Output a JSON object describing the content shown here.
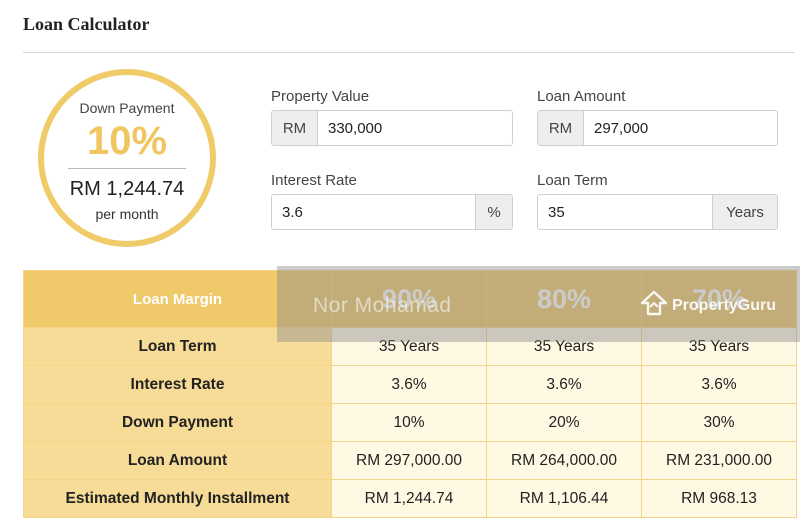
{
  "header": {
    "title": "Loan Calculator"
  },
  "summary": {
    "down_payment_label": "Down Payment",
    "down_payment_pct": "10%",
    "monthly_amount": "RM 1,244.74",
    "per_month": "per month"
  },
  "inputs": {
    "property_value": {
      "label": "Property Value",
      "prefix": "RM",
      "value": "330,000"
    },
    "loan_amount": {
      "label": "Loan Amount",
      "prefix": "RM",
      "value": "297,000"
    },
    "interest_rate": {
      "label": "Interest Rate",
      "suffix": "%",
      "value": "3.6"
    },
    "loan_term": {
      "label": "Loan Term",
      "suffix": "Years",
      "value": "35"
    }
  },
  "table": {
    "header_label": "Loan Margin",
    "margins": [
      "90%",
      "80%",
      "70%"
    ],
    "rows": [
      {
        "label": "Loan Term",
        "values": [
          "35 Years",
          "35 Years",
          "35 Years"
        ]
      },
      {
        "label": "Interest Rate",
        "values": [
          "3.6%",
          "3.6%",
          "3.6%"
        ]
      },
      {
        "label": "Down Payment",
        "values": [
          "10%",
          "20%",
          "30%"
        ]
      },
      {
        "label": "Loan Amount",
        "values": [
          "RM 297,000.00",
          "RM 264,000.00",
          "RM 231,000.00"
        ]
      },
      {
        "label": "Estimated Monthly Installment",
        "values": [
          "RM 1,244.74",
          "RM 1,106.44",
          "RM 968.13"
        ]
      }
    ]
  },
  "watermark": {
    "name": "Nor Mohamad",
    "brand": "PropertyGuru"
  },
  "colors": {
    "accent": "#f0c660",
    "header_bg": "#efc96a",
    "label_bg": "#f7dc97",
    "cell_bg": "#fff8e3"
  }
}
